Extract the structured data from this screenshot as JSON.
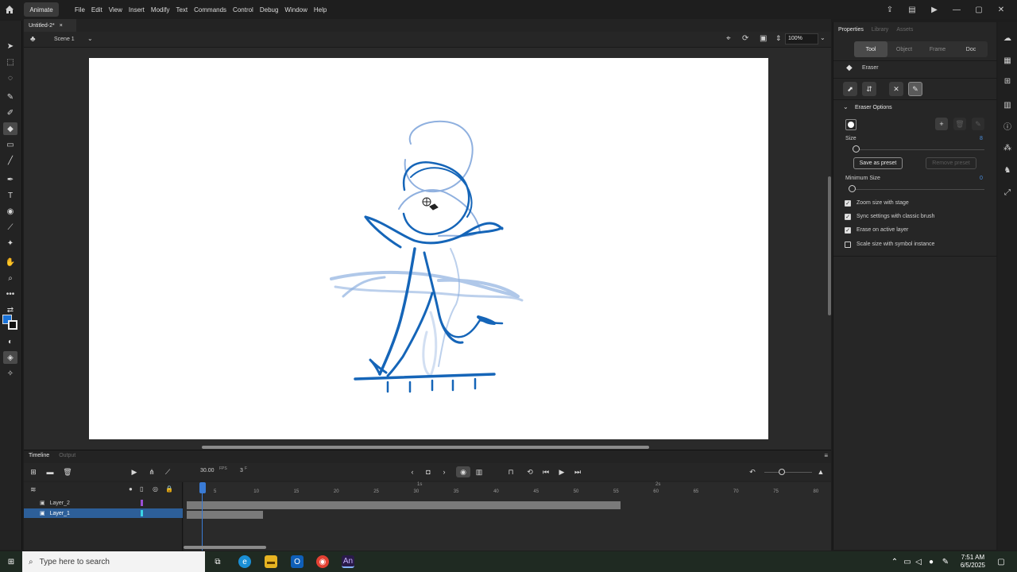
{
  "menubar": {
    "app_label": "Animate",
    "menus": [
      "File",
      "Edit",
      "View",
      "Insert",
      "Modify",
      "Text",
      "Commands",
      "Control",
      "Debug",
      "Window",
      "Help"
    ]
  },
  "document": {
    "tab_title": "Untitled-2*",
    "scene": "Scene 1",
    "zoom": "100%"
  },
  "properties": {
    "tabs": [
      "Properties",
      "Library",
      "Assets"
    ],
    "segments": [
      "Tool",
      "Object",
      "Frame",
      "Doc"
    ],
    "tool_name": "Eraser",
    "section_title": "Eraser Options",
    "size_label": "Size",
    "size_value": "8",
    "save_preset": "Save as preset",
    "remove_preset": "Remove preset",
    "min_size_label": "Minimum Size",
    "min_size_value": "0",
    "options": [
      {
        "label": "Zoom size with stage",
        "checked": true
      },
      {
        "label": "Sync settings with classic brush",
        "checked": true
      },
      {
        "label": "Erase on active layer",
        "checked": true
      },
      {
        "label": "Scale size with symbol instance",
        "checked": false
      }
    ]
  },
  "timeline": {
    "tabs": [
      "Timeline",
      "Output"
    ],
    "fps": "30.00",
    "fps_unit": "FPS",
    "frame": "3",
    "frame_unit": "F",
    "layers": [
      {
        "name": "Layer_2",
        "color": "#9b4fd6",
        "selected": false
      },
      {
        "name": "Layer_1",
        "color": "#39d4e6",
        "selected": true
      }
    ],
    "ruler": [
      "5",
      "10",
      "15",
      "20",
      "25",
      "30",
      "35",
      "40",
      "45",
      "50",
      "55",
      "60",
      "65",
      "70",
      "75",
      "80"
    ],
    "ruler_seconds": [
      "1s",
      "2s"
    ]
  },
  "taskbar": {
    "search_placeholder": "Type here to search",
    "time": "7:51 AM",
    "date": "6/5/2025"
  },
  "colors": {
    "sketch_dark": "#1565b8",
    "sketch_light": "#8fb0df",
    "accent": "#2d5f99"
  }
}
